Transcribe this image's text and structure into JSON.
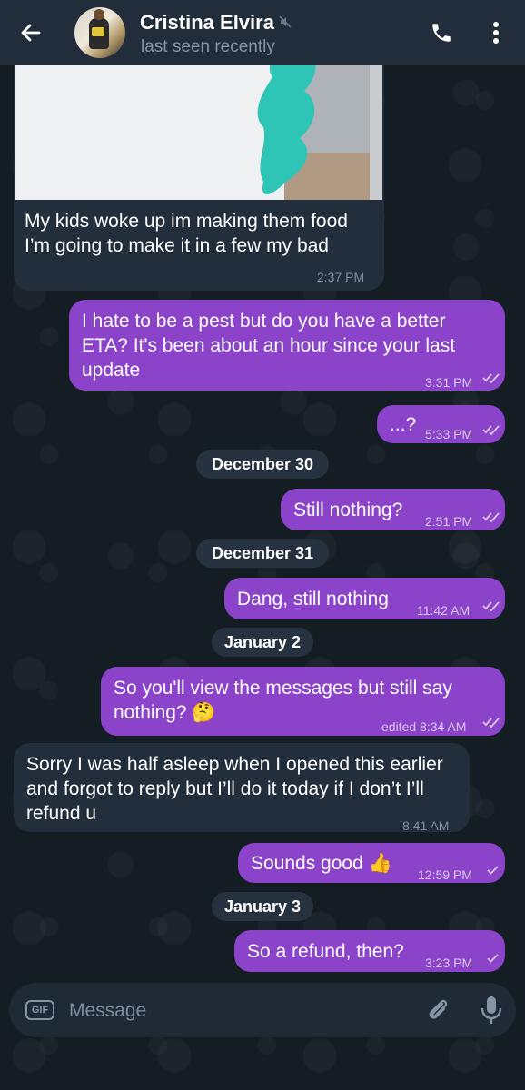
{
  "header": {
    "contact_name": "Cristina Elvira",
    "status": "last seen recently",
    "icons": [
      "back-arrow-icon",
      "mute-icon",
      "phone-icon",
      "more-vert-icon"
    ]
  },
  "messages": [
    {
      "dir": "in",
      "type": "photo",
      "text": "My kids woke up im making them food I’m going to make it in a few my bad",
      "time": "2:37 PM"
    },
    {
      "dir": "out",
      "text": "I hate to be a pest but do you have a better ETA? It's been about an hour since your last update",
      "time": "3:31 PM",
      "read": true
    },
    {
      "dir": "out",
      "text": "...?",
      "time": "5:33 PM",
      "read": true
    },
    {
      "dir": "date",
      "text": "December 30"
    },
    {
      "dir": "out",
      "text": "Still nothing?",
      "time": "2:51 PM",
      "read": true
    },
    {
      "dir": "date",
      "text": "December 31"
    },
    {
      "dir": "out",
      "text": "Dang, still nothing",
      "time": "11:42 AM",
      "read": true
    },
    {
      "dir": "date",
      "text": "January 2"
    },
    {
      "dir": "out",
      "text": "So you'll view the messages but still say nothing? 🤔",
      "time": "edited 8:34 AM",
      "read": true
    },
    {
      "dir": "in",
      "text": "Sorry I was half asleep when I opened this earlier and forgot to reply but I’ll do it today if I don’t I’ll refund u",
      "time": "8:41 AM"
    },
    {
      "dir": "out",
      "text": "Sounds good 👍",
      "time": "12:59 PM",
      "read": false
    },
    {
      "dir": "date",
      "text": "January 3"
    },
    {
      "dir": "out",
      "text": "So a refund, then?",
      "time": "3:23 PM",
      "read": false
    }
  ],
  "composer": {
    "gif_label": "GIF",
    "placeholder": "Message"
  },
  "colors": {
    "background": "#141c24",
    "header": "#212d3b",
    "incoming_bubble": "#232e3c",
    "outgoing_bubble": "#8b44c9",
    "scribble": "#2ec4b6"
  }
}
